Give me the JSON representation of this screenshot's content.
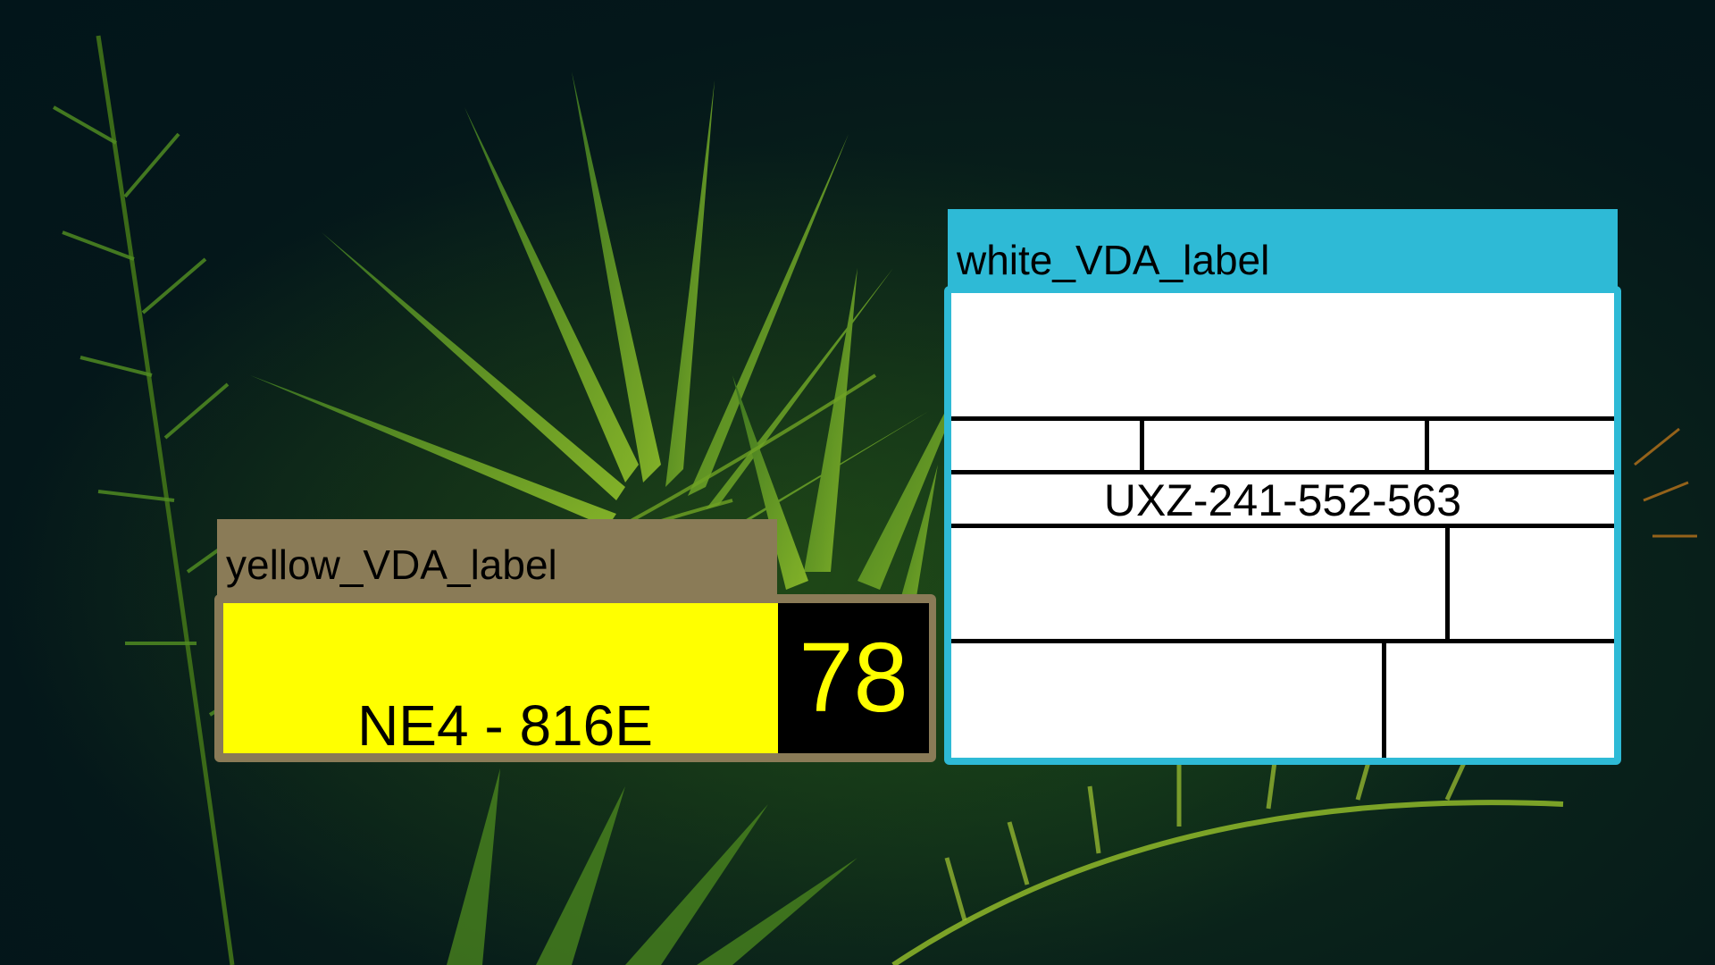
{
  "desktop": {
    "background": "palm-leaves-dark-green"
  },
  "yellow_label": {
    "title": "yellow_VDA_label",
    "plate_text": "NE4 - 816E",
    "number": "78",
    "colors": {
      "frame": "#8a7b57",
      "plate": "#ffff00",
      "number_bg": "#000000",
      "number_fg": "#ffff00"
    }
  },
  "white_label": {
    "title": "white_VDA_label",
    "code": "UXZ-241-552-563",
    "colors": {
      "frame": "#2ebad6",
      "body": "#ffffff",
      "grid": "#000000"
    }
  }
}
